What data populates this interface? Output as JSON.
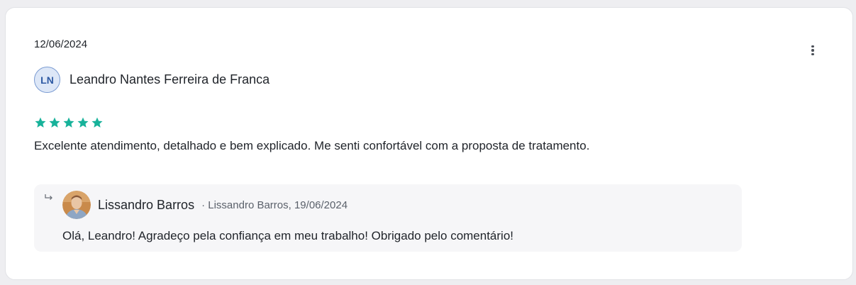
{
  "review": {
    "date": "12/06/2024",
    "author_initials": "LN",
    "author_name": "Leandro Nantes Ferreira de Franca",
    "rating": 5,
    "rating_max": 5,
    "text": "Excelente atendimento, detalhado e bem explicado. Me senti confortável com a proposta de tratamento."
  },
  "reply": {
    "name": "Lissandro Barros",
    "meta": "· Lissandro Barros, 19/06/2024",
    "text": "Olá, Leandro! Agradeço pela confiança em meu trabalho! Obrigado pelo comentário!"
  },
  "colors": {
    "star": "#17b29a",
    "avatar_bg": "#dde7f7",
    "avatar_text": "#2e5aa3",
    "reply_bg": "#f6f6f8"
  },
  "icons": {
    "menu": "more-vertical-icon",
    "reply": "reply-arrow-icon"
  }
}
